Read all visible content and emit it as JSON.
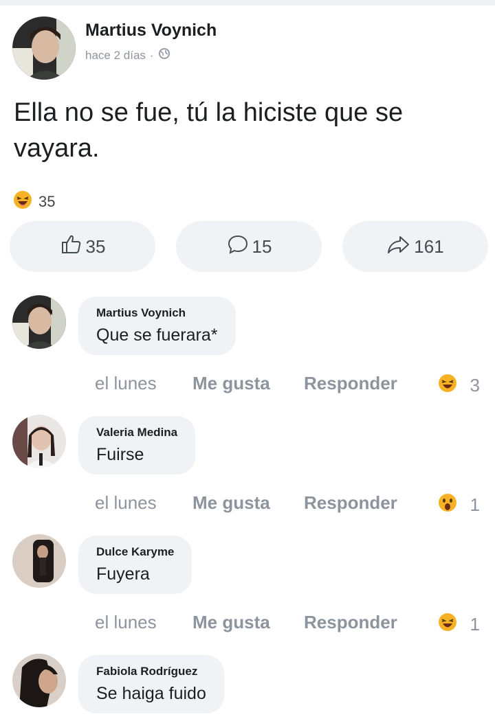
{
  "post": {
    "author": "Martius Voynich",
    "time": "hace 2 días",
    "separator": "·",
    "privacy_icon": "globe-icon",
    "text": "Ella no se fue, tú la hiciste que se vayara.",
    "reaction_icon": "haha-emoji-icon",
    "reaction_count": "35",
    "actions": {
      "like_count": "35",
      "comment_count": "15",
      "share_count": "161"
    }
  },
  "comments": [
    {
      "author": "Martius Voynich",
      "text": "Que se fuerara*",
      "time": "el lunes",
      "like_label": "Me gusta",
      "reply_label": "Responder",
      "reaction_icon": "haha-emoji-icon",
      "reaction_count": "3"
    },
    {
      "author": "Valeria Medina",
      "text": "Fuirse",
      "time": "el lunes",
      "like_label": "Me gusta",
      "reply_label": "Responder",
      "reaction_icon": "wow-emoji-icon",
      "reaction_count": "1"
    },
    {
      "author": "Dulce Karyme",
      "text": "Fuyera",
      "time": "el lunes",
      "like_label": "Me gusta",
      "reply_label": "Responder",
      "reaction_icon": "haha-emoji-icon",
      "reaction_count": "1"
    },
    {
      "author": "Fabiola Rodríguez",
      "text": "Se haiga fuido"
    }
  ],
  "colors": {
    "bubble": "#f0f2f5",
    "muted_text": "#8d949e",
    "emoji_yellow": "#f7b125"
  }
}
